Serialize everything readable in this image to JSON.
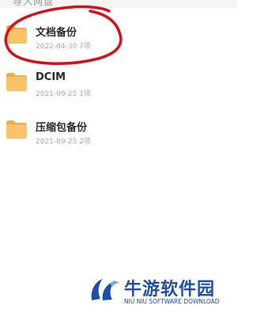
{
  "header": {
    "partial_text": "导入网盘"
  },
  "files": [
    {
      "name": "文档备份",
      "date": "2022-04-30",
      "count": "7项"
    },
    {
      "name": "DCIM",
      "date": "2021-09-25",
      "count": "1项"
    },
    {
      "name": "压缩包备份",
      "date": "2021-09-25",
      "count": "2项"
    }
  ],
  "colors": {
    "folder": "#f9c36a",
    "folder_dark": "#f0ad4a",
    "annotation": "#d4101a",
    "watermark": "#1f4ea8"
  },
  "watermark": {
    "title": "牛游软件园",
    "subtitle": "NIU NIU SOFTWARE DOWNLOAD"
  }
}
